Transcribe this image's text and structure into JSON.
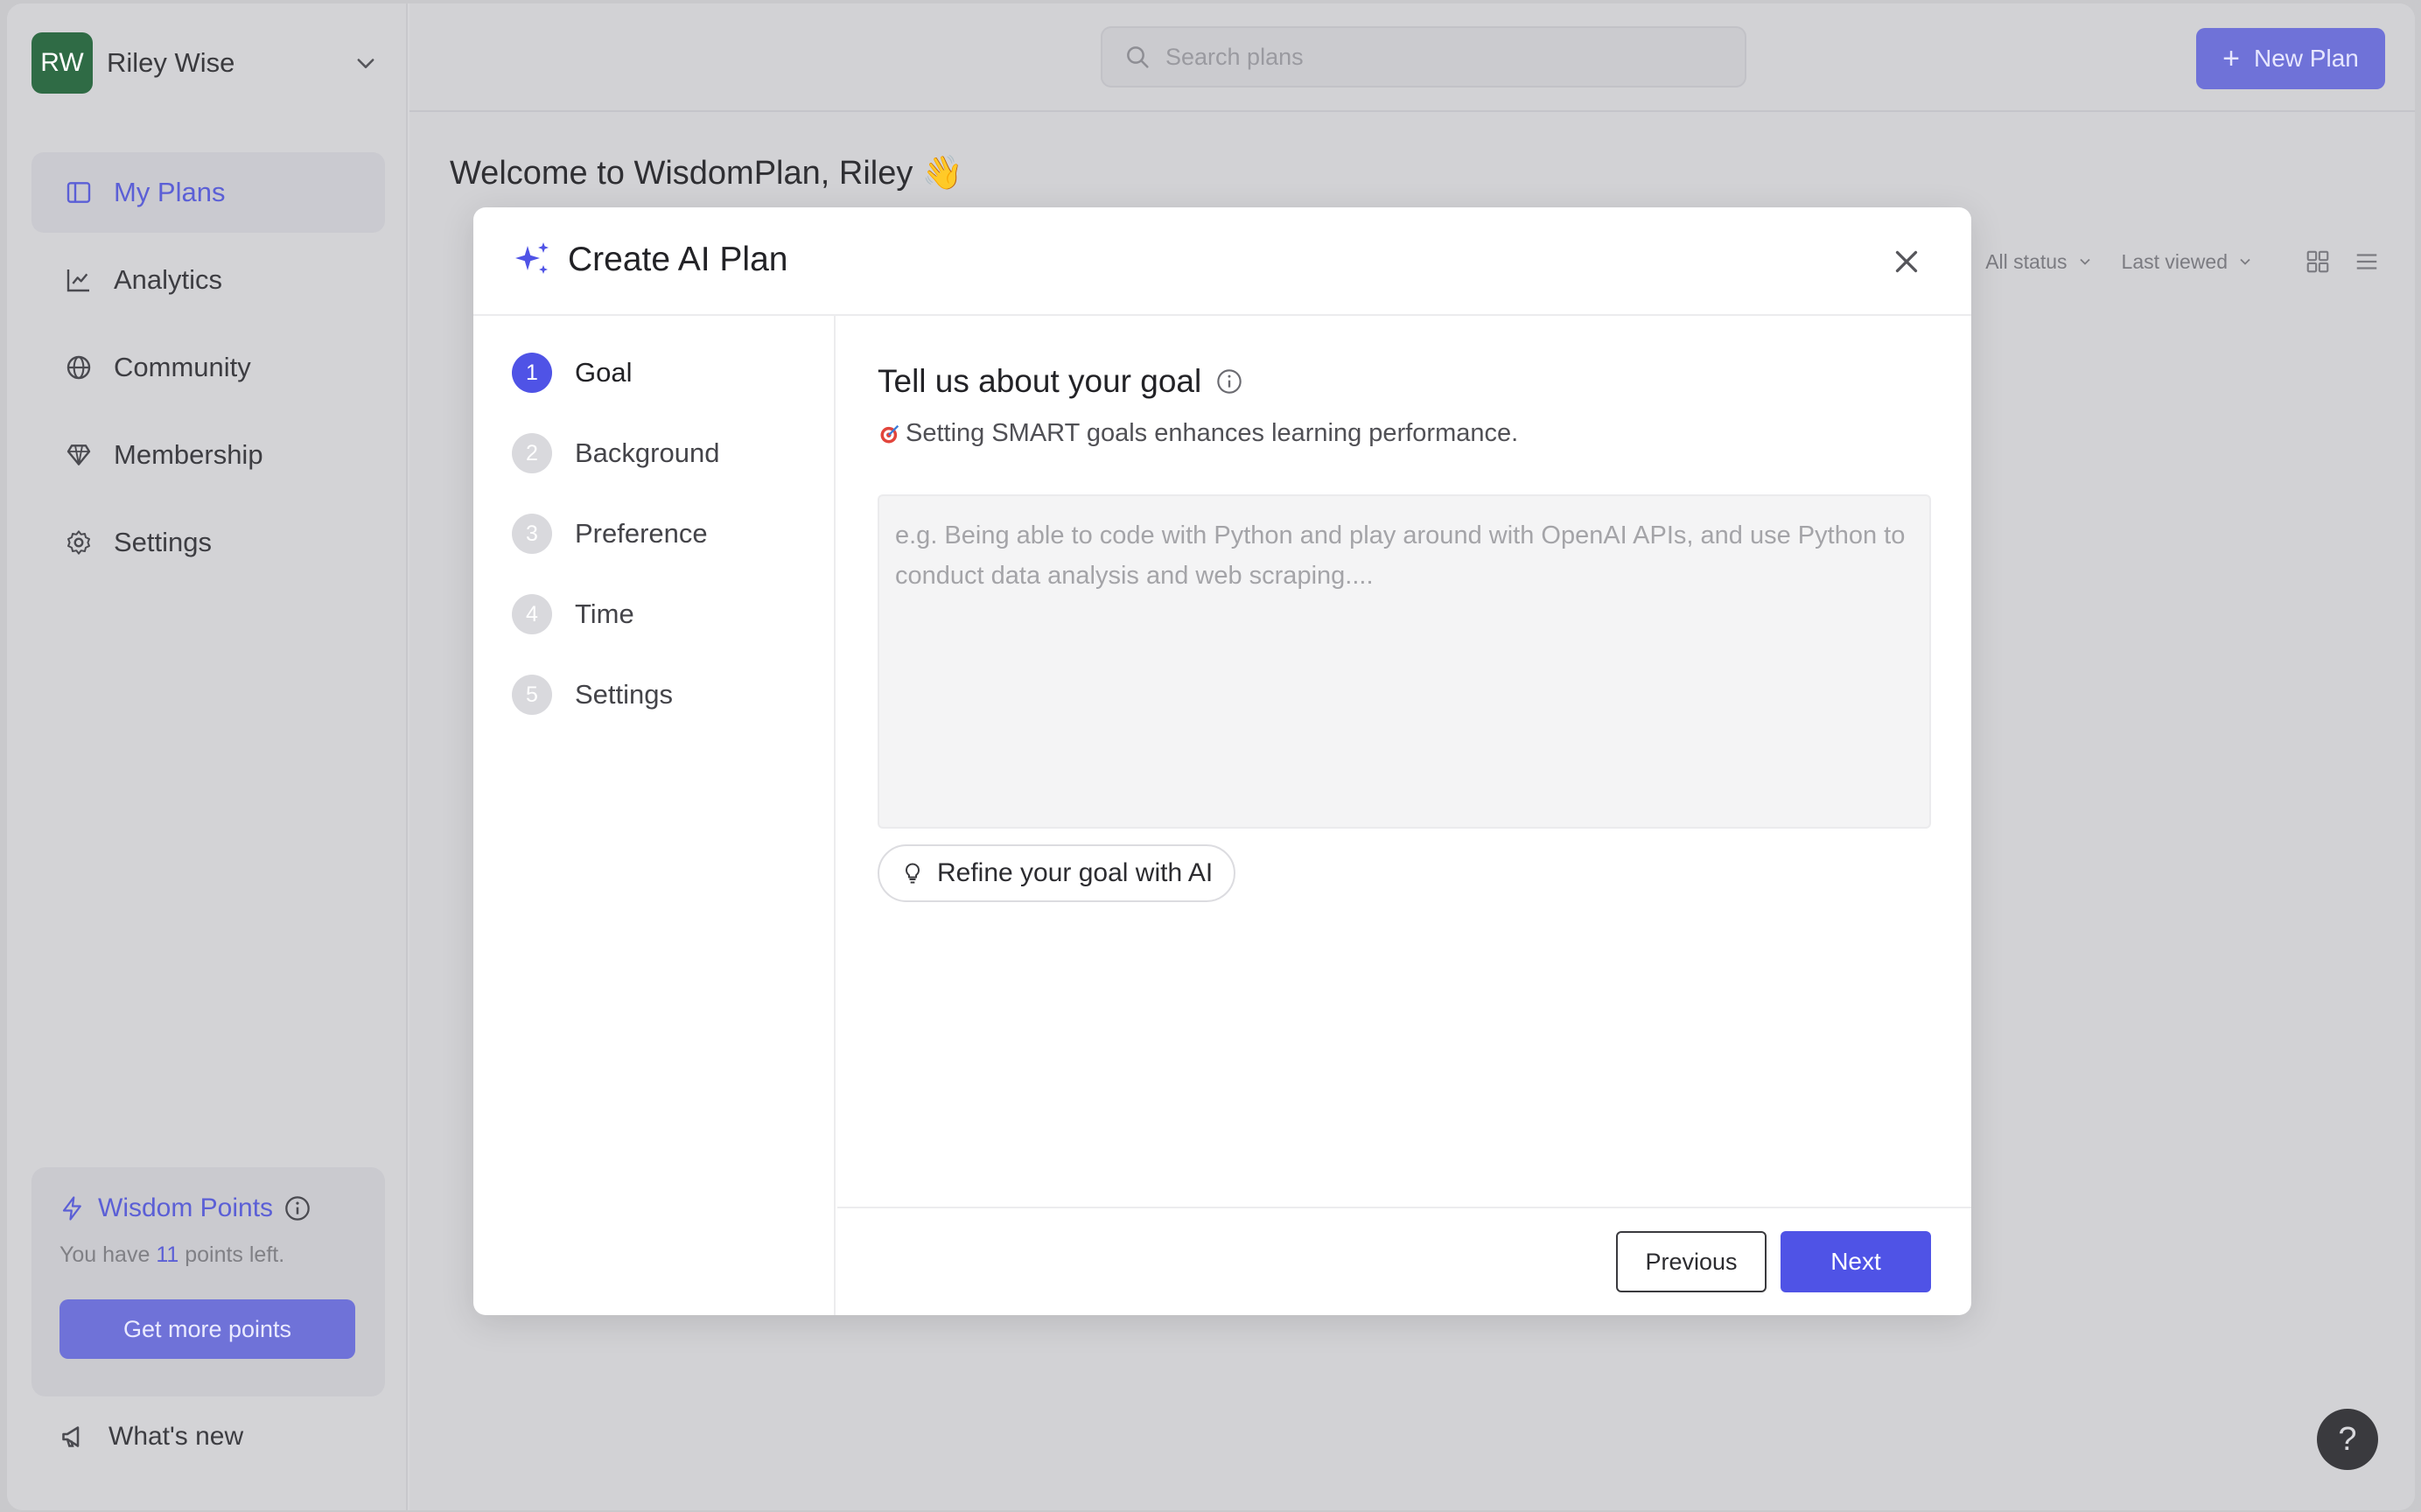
{
  "user": {
    "initials": "RW",
    "name": "Riley Wise"
  },
  "nav": [
    {
      "label": "My Plans",
      "icon": "sidebar-panel-icon",
      "active": true
    },
    {
      "label": "Analytics",
      "icon": "chart-line-icon"
    },
    {
      "label": "Community",
      "icon": "globe-icon"
    },
    {
      "label": "Membership",
      "icon": "gem-icon"
    },
    {
      "label": "Settings",
      "icon": "gear-icon"
    }
  ],
  "points": {
    "title": "Wisdom Points",
    "text_prefix": "You have",
    "count": "11",
    "text_suffix": "points left.",
    "button": "Get more points"
  },
  "whats_new": "What's new",
  "search": {
    "placeholder": "Search plans"
  },
  "new_plan": {
    "label": "New Plan"
  },
  "welcome": "Welcome to WisdomPlan, Riley 👋",
  "filters": {
    "status": "All status",
    "sort": "Last viewed"
  },
  "modal": {
    "title": "Create AI Plan",
    "steps": [
      {
        "num": "1",
        "label": "Goal",
        "active": true
      },
      {
        "num": "2",
        "label": "Background"
      },
      {
        "num": "3",
        "label": "Preference"
      },
      {
        "num": "4",
        "label": "Time"
      },
      {
        "num": "5",
        "label": "Settings"
      }
    ],
    "goal_title": "Tell us about your goal",
    "goal_tip": "Setting SMART goals enhances learning performance.",
    "goal_placeholder": "e.g. Being able to code with Python and play around with OpenAI APIs, and use Python to conduct data analysis and web scraping....",
    "refine_label": "Refine your goal with AI",
    "previous": "Previous",
    "next": "Next"
  },
  "help": "?",
  "colors": {
    "accent": "#4f53e6",
    "accent_muted": "#6f72d8",
    "avatar": "#2f6b45"
  }
}
